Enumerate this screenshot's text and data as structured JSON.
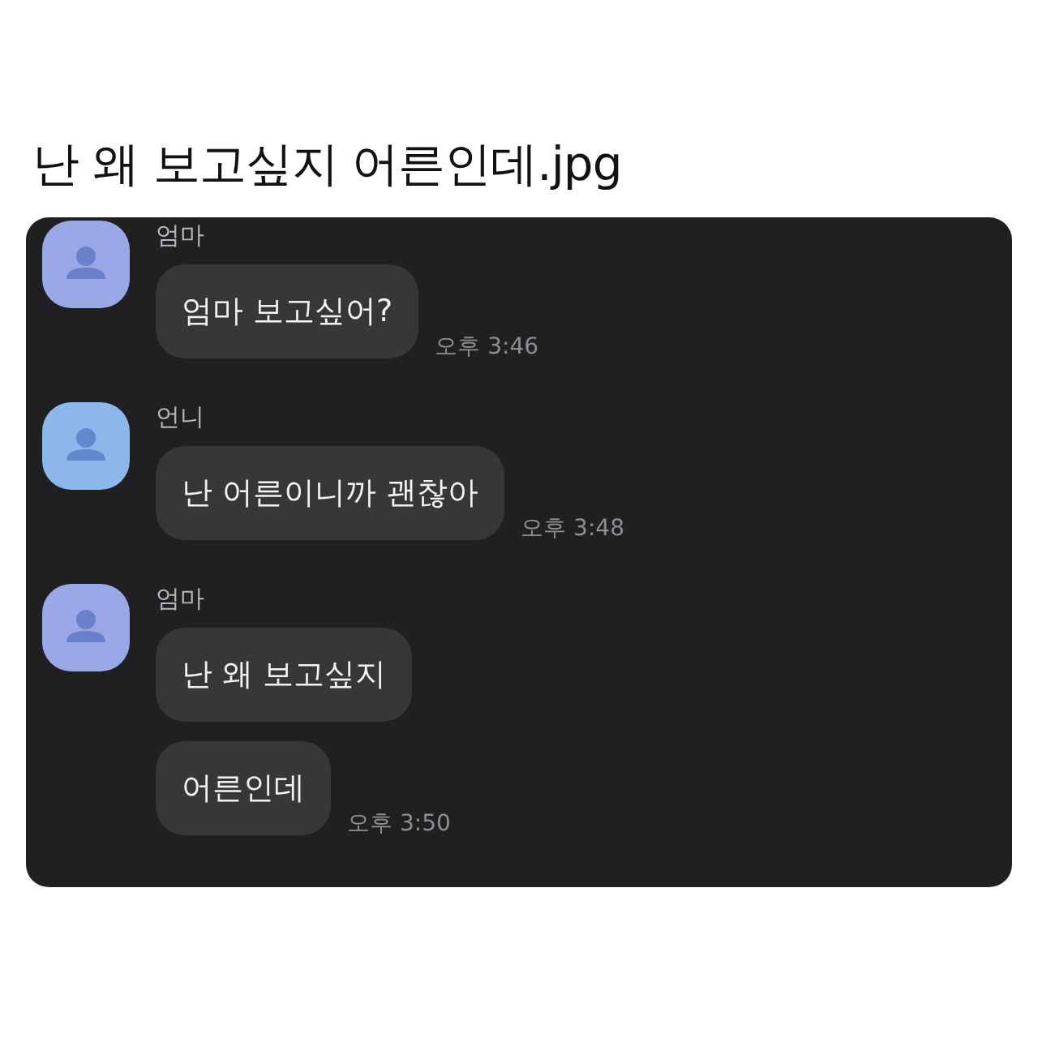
{
  "post": {
    "title": "난 왜 보고싶지 어른인데.jpg"
  },
  "chat": {
    "groups": [
      {
        "sender": "엄마",
        "color": "#9aa8e8",
        "messages": [
          "엄마 보고싶어?"
        ],
        "time": "오후 3:46"
      },
      {
        "sender": "언니",
        "color": "#8cb7ea",
        "messages": [
          "난 어른이니까 괜찮아"
        ],
        "time": "오후 3:48"
      },
      {
        "sender": "엄마",
        "color": "#9aa8e8",
        "messages": [
          "난 왜 보고싶지",
          "어른인데"
        ],
        "time": "오후 3:50"
      }
    ]
  }
}
